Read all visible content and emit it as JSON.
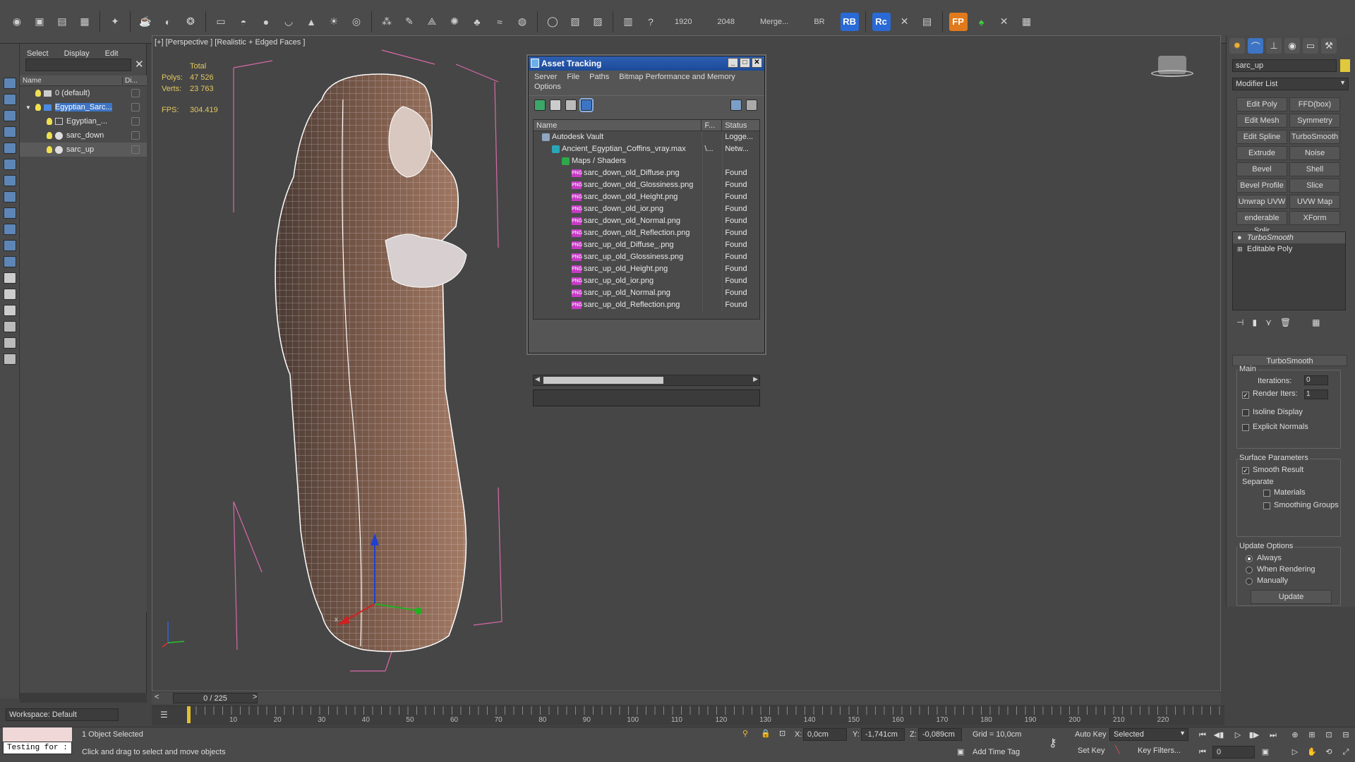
{
  "toolbar": {
    "readout_width": "1920",
    "readout_height": "2048",
    "merge_label": "Merge...",
    "br_label": "BR",
    "rb_label": "RB",
    "rc_label": "Rc",
    "fp_label": "FP",
    "colors": {
      "rb": "#2a6ad6",
      "rc": "#2a6ad6",
      "fp": "#e07a1c"
    }
  },
  "explorer": {
    "menu": [
      "Select",
      "Display",
      "Edit"
    ],
    "columns": {
      "name": "Name",
      "display": "Di..."
    },
    "rows": [
      {
        "label": "0 (default)"
      },
      {
        "label": "Egyptian_Sarc..."
      },
      {
        "label": "Egyptian_..."
      },
      {
        "label": "sarc_down"
      },
      {
        "label": "sarc_up"
      }
    ],
    "workspace": "Workspace: Default"
  },
  "viewport": {
    "label": "[+] [Perspective ] [Realistic + Edged Faces ]",
    "stats": {
      "total_label": "Total",
      "polys_label": "Polys:",
      "polys": "47 526",
      "verts_label": "Verts:",
      "verts": "23 763",
      "fps_label": "FPS:",
      "fps": "304.419"
    }
  },
  "asset_tracking": {
    "title": "Asset Tracking",
    "menu": [
      "Server",
      "File",
      "Paths",
      "Bitmap Performance and Memory"
    ],
    "menu2": "Options",
    "columns": {
      "name": "Name",
      "full_path": "F...",
      "status": "Status"
    },
    "rows": [
      {
        "name": "Autodesk Vault",
        "path": "",
        "status": "Logge...",
        "kind": "vault",
        "indent": 1
      },
      {
        "name": "Ancient_Egyptian_Coffins_vray.max",
        "path": "\\...",
        "status": "Netw...",
        "kind": "max",
        "indent": 2
      },
      {
        "name": "Maps / Shaders",
        "path": "",
        "status": "",
        "kind": "maps",
        "indent": 3
      },
      {
        "name": "sarc_down_old_Diffuse.png",
        "path": "",
        "status": "Found",
        "kind": "png",
        "indent": 4
      },
      {
        "name": "sarc_down_old_Glossiness.png",
        "path": "",
        "status": "Found",
        "kind": "png",
        "indent": 4
      },
      {
        "name": "sarc_down_old_Height.png",
        "path": "",
        "status": "Found",
        "kind": "png",
        "indent": 4
      },
      {
        "name": "sarc_down_old_ior.png",
        "path": "",
        "status": "Found",
        "kind": "png",
        "indent": 4
      },
      {
        "name": "sarc_down_old_Normal.png",
        "path": "",
        "status": "Found",
        "kind": "png",
        "indent": 4
      },
      {
        "name": "sarc_down_old_Reflection.png",
        "path": "",
        "status": "Found",
        "kind": "png",
        "indent": 4
      },
      {
        "name": "sarc_up_old_Diffuse_.png",
        "path": "",
        "status": "Found",
        "kind": "png",
        "indent": 4
      },
      {
        "name": "sarc_up_old_Glossiness.png",
        "path": "",
        "status": "Found",
        "kind": "png",
        "indent": 4
      },
      {
        "name": "sarc_up_old_Height.png",
        "path": "",
        "status": "Found",
        "kind": "png",
        "indent": 4
      },
      {
        "name": "sarc_up_old_ior.png",
        "path": "",
        "status": "Found",
        "kind": "png",
        "indent": 4
      },
      {
        "name": "sarc_up_old_Normal.png",
        "path": "",
        "status": "Found",
        "kind": "png",
        "indent": 4
      },
      {
        "name": "sarc_up_old_Reflection.png",
        "path": "",
        "status": "Found",
        "kind": "png",
        "indent": 4
      }
    ]
  },
  "command_panel": {
    "object_name": "sarc_up",
    "modifier_list": "Modifier List",
    "modifier_buttons": [
      "Edit Poly",
      "FFD(box)",
      "Edit Mesh",
      "Symmetry",
      "Edit Spline",
      "TurboSmooth",
      "Extrude",
      "Noise",
      "Bevel",
      "Shell",
      "Bevel Profile",
      "Slice",
      "Unwrap UVW",
      "UVW Map",
      "enderable Splir",
      "XForm"
    ],
    "stack": [
      "TurboSmooth",
      "Editable Poly"
    ],
    "rollout_title": "TurboSmooth",
    "main_label": "Main",
    "iterations_label": "Iterations:",
    "iterations": "0",
    "render_iters_label": "Render Iters:",
    "render_iters": "1",
    "isoline_label": "Isoline Display",
    "explicit_normals_label": "Explicit Normals",
    "surface_params_label": "Surface Parameters",
    "smooth_result_label": "Smooth Result",
    "separate_label": "Separate",
    "materials_label": "Materials",
    "smoothing_groups_label": "Smoothing Groups",
    "update_options_label": "Update Options",
    "always_label": "Always",
    "when_rendering_label": "When Rendering",
    "manually_label": "Manually",
    "update_button": "Update"
  },
  "timeline": {
    "frame": "0 / 225",
    "ticks": [
      "10",
      "20",
      "30",
      "40",
      "50",
      "60",
      "70",
      "80",
      "90",
      "100",
      "110",
      "120",
      "130",
      "140",
      "150",
      "160",
      "170",
      "180",
      "190",
      "200",
      "210",
      "220"
    ]
  },
  "status_bar": {
    "script_field": "Testing for :",
    "selection": "1 Object Selected",
    "prompt": "Click and drag to select and move objects",
    "x_label": "X:",
    "x": "0,0cm",
    "y_label": "Y:",
    "y": "-1,741cm",
    "z_label": "Z:",
    "z": "-0,089cm",
    "grid": "Grid = 10,0cm",
    "add_time_tag": "Add Time Tag",
    "auto_key": "Auto Key",
    "selected": "Selected",
    "set_key": "Set Key",
    "key_filters": "Key Filters...",
    "frame_field": "0"
  }
}
